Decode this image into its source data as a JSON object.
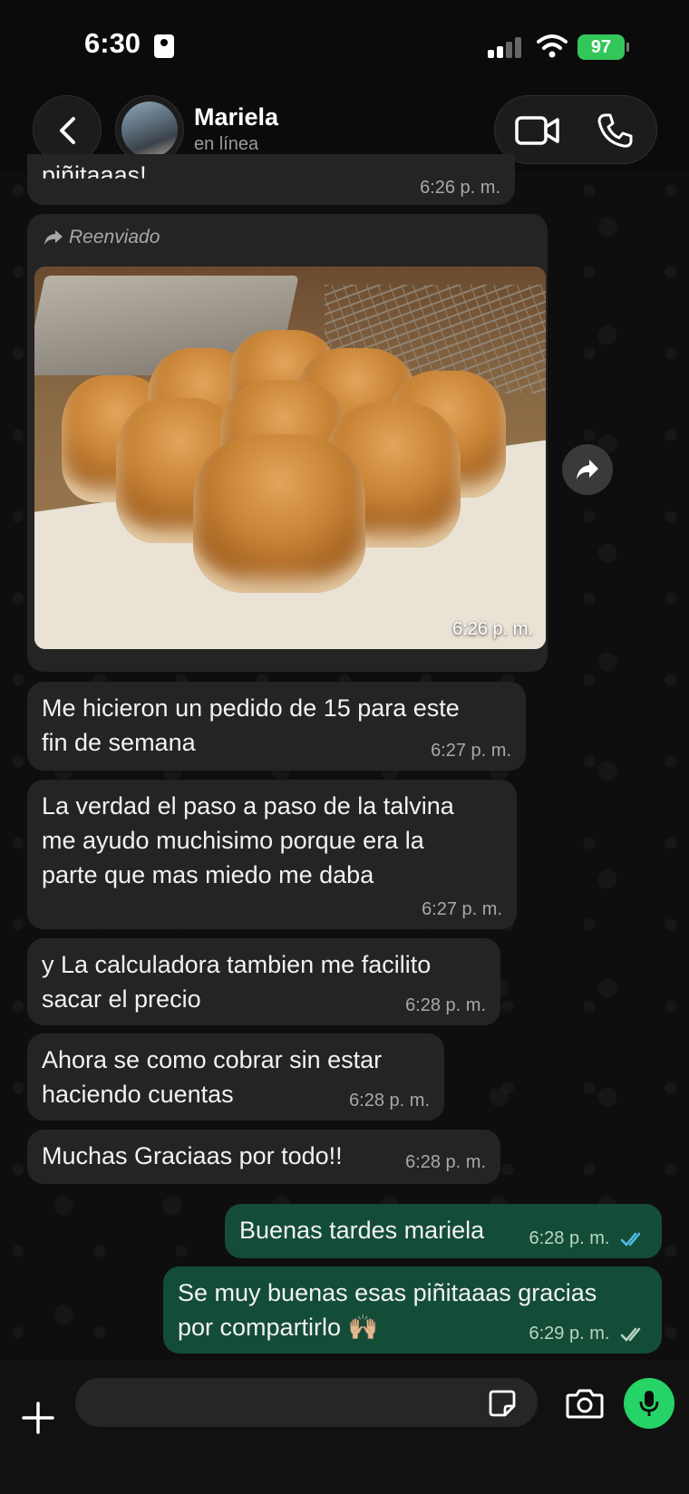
{
  "status_bar": {
    "time": "6:30",
    "battery": "97"
  },
  "header": {
    "contact_name": "Mariela",
    "contact_status": "en línea"
  },
  "messages": [
    {
      "direction": "in",
      "text": "piñitaaas!",
      "time": "6:26 p. m.",
      "partial": true
    },
    {
      "direction": "in",
      "type": "image",
      "forwarded_label": "Reenviado",
      "image_alt": "pan de leche recién horneado",
      "time": "6:26 p. m."
    },
    {
      "direction": "in",
      "line1": "Me hicieron un pedido de 15 para este",
      "line2": "fin de semana",
      "time": "6:27 p. m."
    },
    {
      "direction": "in",
      "line1": "La verdad el paso a paso de la talvina",
      "line2": "me ayudo muchisimo porque era la",
      "line3": "parte que mas miedo me daba",
      "time": "6:27 p. m."
    },
    {
      "direction": "in",
      "line1": "y La calculadora tambien me facilito",
      "line2": "sacar el precio",
      "time": "6:28 p. m."
    },
    {
      "direction": "in",
      "line1": "Ahora se como cobrar sin estar",
      "line2": "haciendo cuentas",
      "time": "6:28 p. m."
    },
    {
      "direction": "in",
      "line1": "Muchas Graciaas por todo!!",
      "time": "6:28 p. m."
    },
    {
      "direction": "out",
      "line1": "Buenas tardes mariela",
      "time": "6:28 p. m.",
      "read": true
    },
    {
      "direction": "out",
      "line1": "Se muy buenas esas piñitaaas gracias",
      "line2": "por compartirlo 🙌🏼",
      "time": "6:29 p. m.",
      "read": false
    }
  ],
  "input": {
    "placeholder": ""
  },
  "colors": {
    "incoming_bubble": "#242424",
    "outgoing_bubble": "#144d37",
    "accent": "#25d366",
    "read_check": "#53bdeb"
  },
  "icons": [
    "back-chevron-icon",
    "video-call-icon",
    "phone-icon",
    "forward-icon",
    "share-icon",
    "plus-icon",
    "sticker-icon",
    "camera-icon",
    "microphone-icon"
  ]
}
